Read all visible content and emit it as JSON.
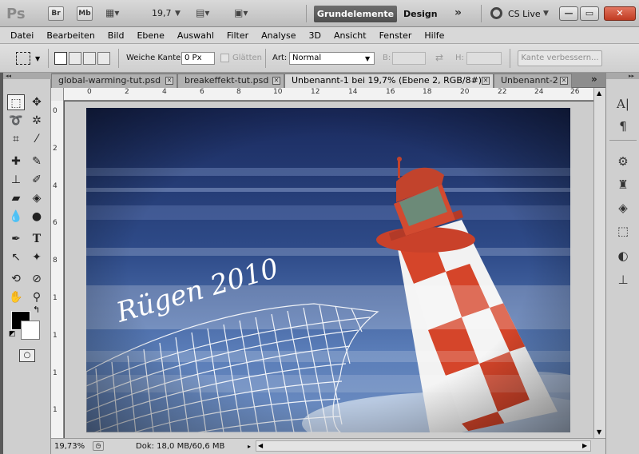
{
  "appbar": {
    "logo": "Ps",
    "br": "Br",
    "mb": "Mb",
    "zoom": "19,7",
    "workspace_active": "Grundelemente",
    "workspace_other": "Design",
    "more": "»",
    "cs_live": "CS Live",
    "minimize": "—",
    "restore": "▭",
    "close": "✕"
  },
  "menu": [
    "Datei",
    "Bearbeiten",
    "Bild",
    "Ebene",
    "Auswahl",
    "Filter",
    "Analyse",
    "3D",
    "Ansicht",
    "Fenster",
    "Hilfe"
  ],
  "options": {
    "feather_label": "Weiche Kante:",
    "feather_value": "0 Px",
    "smooth_label": "Glätten",
    "style_label": "Art:",
    "style_value": "Normal",
    "width_label": "B:",
    "height_label": "H:",
    "refine_button": "Kante verbessern..."
  },
  "tabs": [
    {
      "label": "global-warming-tut.psd"
    },
    {
      "label": "breakeffekt-tut.psd"
    },
    {
      "label": "Unbenannt-1 bei 19,7% (Ebene 2, RGB/8#) *"
    },
    {
      "label": "Unbenannt-2"
    }
  ],
  "tab_overflow": "»",
  "ruler_top": [
    "0",
    "2",
    "4",
    "6",
    "8",
    "10",
    "12",
    "14",
    "16",
    "18",
    "20",
    "22",
    "24",
    "26"
  ],
  "ruler_left": [
    "0",
    "2",
    "4",
    "6",
    "8",
    "1",
    "1",
    "1",
    "1"
  ],
  "artwork": {
    "script_text": "Rügen 2010"
  },
  "status": {
    "zoom": "19,73%",
    "doc": "Dok: 18,0 MB/60,6 MB"
  },
  "colors": {
    "workspace_active_bg": "#5e5e5e",
    "close_button": "#c8442a",
    "sky_dark": "#1e2f66",
    "lighthouse_red": "#d5452a"
  }
}
